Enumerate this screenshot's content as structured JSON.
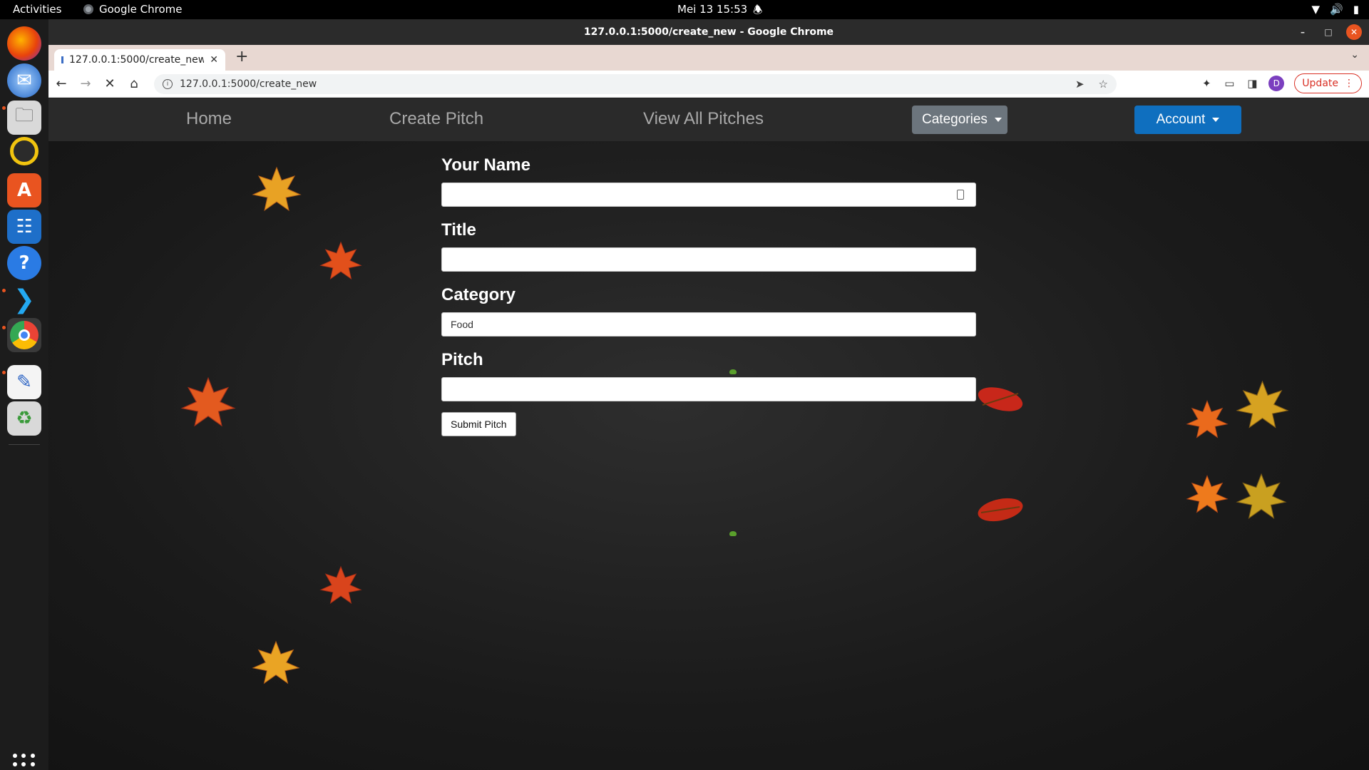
{
  "system_bar": {
    "activities": "Activities",
    "app_name": "Google Chrome",
    "clock": "Mei 13  15:53"
  },
  "window": {
    "title": "127.0.0.1:5000/create_new - Google Chrome"
  },
  "browser": {
    "tab_title": "127.0.0.1:5000/create_new",
    "url": "127.0.0.1:5000/create_new",
    "profile_initial": "D",
    "update_label": "Update"
  },
  "site": {
    "nav": {
      "home": "Home",
      "create_pitch": "Create Pitch",
      "view_all": "View All Pitches",
      "categories": "Categories",
      "account": "Account"
    },
    "form": {
      "name_label": "Your Name",
      "name_value": "",
      "title_label": "Title",
      "title_value": "",
      "category_label": "Category",
      "category_value": "Food",
      "pitch_label": "Pitch",
      "pitch_value": "",
      "submit_label": "Submit Pitch"
    }
  },
  "colors": {
    "categories_button": "#6c757d",
    "account_button": "#0f6fbf",
    "update_accent": "#d93025"
  }
}
